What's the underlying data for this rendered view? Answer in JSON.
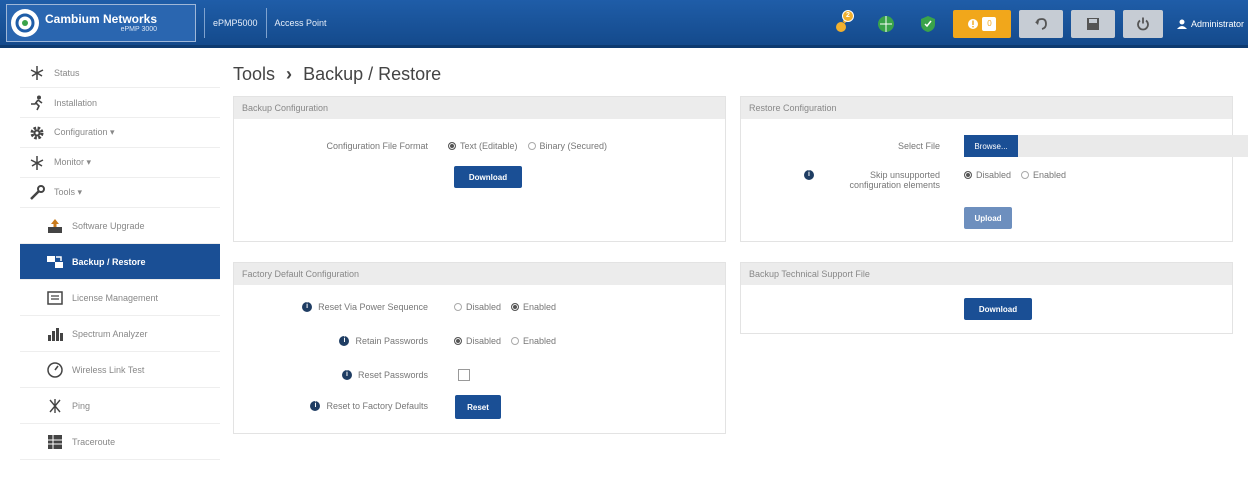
{
  "header": {
    "brand": "Cambium Networks",
    "model": "ePMP 3000",
    "device": "ePMP5000",
    "mode": "Access Point",
    "notifications_count": "2",
    "alarms_count": "0",
    "user": "Administrator"
  },
  "sidebar": {
    "items": [
      {
        "label": "Status",
        "icon": "antenna-icon"
      },
      {
        "label": "Installation",
        "icon": "runner-icon"
      },
      {
        "label": "Configuration ▾",
        "icon": "gear-icon"
      },
      {
        "label": "Monitor ▾",
        "icon": "monitor-antenna-icon"
      },
      {
        "label": "Tools ▾",
        "icon": "wrench-icon"
      },
      {
        "label": "Software Upgrade",
        "icon": "upgrade-icon"
      },
      {
        "label": "Backup / Restore",
        "icon": "backup-icon"
      },
      {
        "label": "License Management",
        "icon": "license-icon"
      },
      {
        "label": "Spectrum Analyzer",
        "icon": "bar-chart-icon"
      },
      {
        "label": "Wireless Link Test",
        "icon": "gauge-icon"
      },
      {
        "label": "Ping",
        "icon": "ping-icon"
      },
      {
        "label": "Traceroute",
        "icon": "traceroute-icon"
      }
    ]
  },
  "page": {
    "title": "Tools",
    "subtitle": "Backup / Restore",
    "separator": "›"
  },
  "backup": {
    "heading": "Backup Configuration",
    "format_label": "Configuration File Format",
    "opt_text": "Text (Editable)",
    "opt_binary": "Binary (Secured)",
    "download": "Download"
  },
  "restore": {
    "heading": "Restore Configuration",
    "select_label": "Select File",
    "browse": "Browse...",
    "skip_label": "Skip unsupported configuration elements",
    "opt_disabled": "Disabled",
    "opt_enabled": "Enabled",
    "upload": "Upload"
  },
  "factory": {
    "heading": "Factory Default Configuration",
    "reset_power_label": "Reset Via Power Sequence",
    "retain_pw_label": "Retain Passwords",
    "reset_pw_label": "Reset Passwords",
    "reset_factory_label": "Reset to Factory Defaults",
    "opt_disabled": "Disabled",
    "opt_enabled": "Enabled",
    "reset": "Reset"
  },
  "tech_support": {
    "heading": "Backup Technical Support File",
    "download": "Download"
  }
}
